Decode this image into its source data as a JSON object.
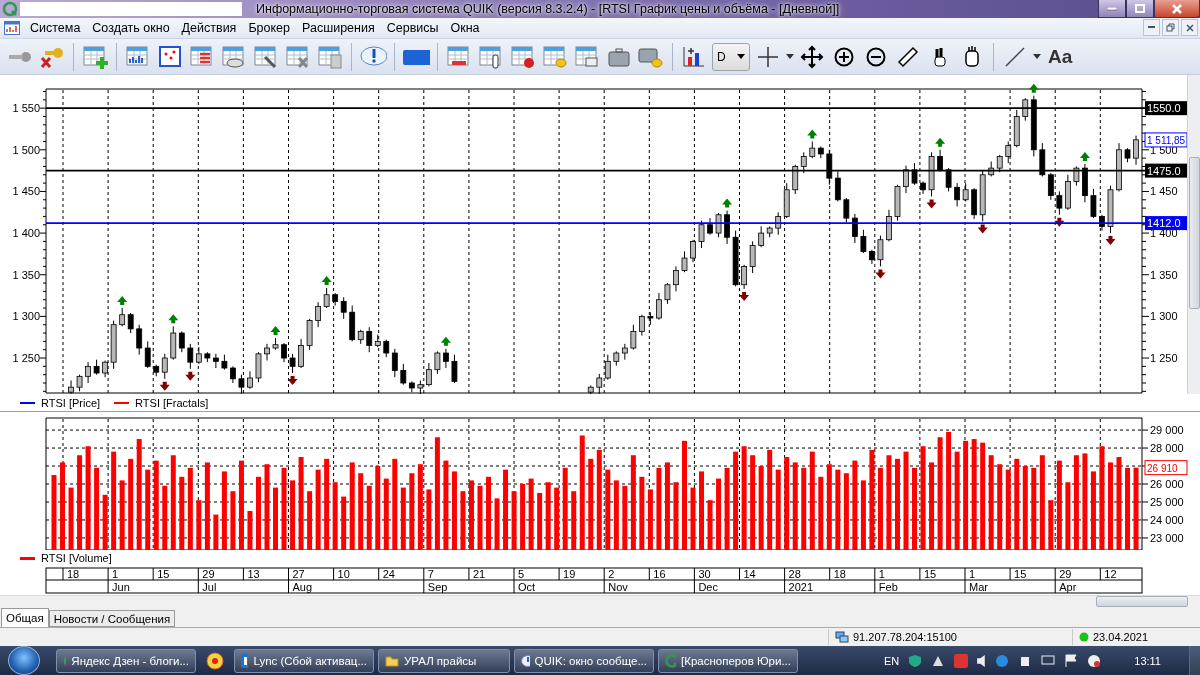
{
  "window": {
    "title": "Информационно-торговая система QUIK (версия 8.3.2.4) - [RTSI График цены и объёма - [Дневной]]"
  },
  "menu": [
    "Система",
    "Создать окно",
    "Действия",
    "Брокер",
    "Расширения",
    "Сервисы",
    "Окна"
  ],
  "toolbar": {
    "interval": "D",
    "font_button": "Aa"
  },
  "price_chart": {
    "legend": [
      {
        "label": "RTSI [Price]",
        "color": "#0000ff"
      },
      {
        "label": "RTSI [Fractals]",
        "color": "#ff0000"
      }
    ],
    "right_axis": {
      "labels": [
        "1 500",
        "1 450",
        "1 400",
        "1 350",
        "1 300",
        "1 250"
      ]
    },
    "chart_data": {
      "type": "candlestick",
      "ylim": [
        1208,
        1573
      ],
      "grid": true,
      "yticks": [
        {
          "value": 1250,
          "label": "1 250"
        },
        {
          "value": 1300,
          "label": "1 300"
        },
        {
          "value": 1350,
          "label": "1 350"
        },
        {
          "value": 1400,
          "label": "1 400"
        },
        {
          "value": 1450,
          "label": "1 450"
        },
        {
          "value": 1500,
          "label": "1 500"
        },
        {
          "value": 1550,
          "label": "1 550"
        }
      ],
      "ohlc": [
        null,
        null,
        [
          1209,
          1223,
          1207,
          1215
        ],
        [
          1215,
          1230,
          1210,
          1228
        ],
        [
          1228,
          1245,
          1220,
          1240
        ],
        [
          1240,
          1248,
          1230,
          1232
        ],
        [
          1232,
          1247,
          1227,
          1245
        ],
        [
          1245,
          1295,
          1237,
          1290
        ],
        [
          1290,
          1310,
          1288,
          1302
        ],
        [
          1302,
          1304,
          1280,
          1285
        ],
        [
          1285,
          1290,
          1254,
          1262
        ],
        [
          1262,
          1270,
          1238,
          1240
        ],
        [
          1240,
          1242,
          1228,
          1233
        ],
        [
          1233,
          1255,
          1225,
          1250
        ],
        [
          1250,
          1288,
          1248,
          1280
        ],
        [
          1280,
          1282,
          1257,
          1262
        ],
        [
          1262,
          1267,
          1237,
          1245
        ],
        [
          1245,
          1263,
          1243,
          1255
        ],
        [
          1255,
          1257,
          1245,
          1250
        ],
        [
          1250,
          1255,
          1238,
          1246
        ],
        [
          1246,
          1254,
          1236,
          1238
        ],
        [
          1238,
          1240,
          1220,
          1225
        ],
        [
          1225,
          1230,
          1207,
          1215
        ],
        [
          1215,
          1234,
          1213,
          1226
        ],
        [
          1226,
          1257,
          1221,
          1255
        ],
        [
          1255,
          1267,
          1247,
          1262
        ],
        [
          1262,
          1274,
          1260,
          1266
        ],
        [
          1266,
          1268,
          1245,
          1250
        ],
        [
          1250,
          1255,
          1232,
          1240
        ],
        [
          1240,
          1273,
          1238,
          1265
        ],
        [
          1265,
          1297,
          1260,
          1295
        ],
        [
          1295,
          1317,
          1287,
          1312
        ],
        [
          1312,
          1334,
          1310,
          1326
        ],
        [
          1326,
          1328,
          1313,
          1318
        ],
        [
          1318,
          1323,
          1297,
          1305
        ],
        [
          1305,
          1313,
          1270,
          1272
        ],
        [
          1272,
          1284,
          1267,
          1282
        ],
        [
          1282,
          1287,
          1257,
          1265
        ],
        [
          1265,
          1278,
          1263,
          1270
        ],
        [
          1270,
          1272,
          1251,
          1256
        ],
        [
          1256,
          1261,
          1227,
          1235
        ],
        [
          1235,
          1243,
          1218,
          1220
        ],
        [
          1220,
          1222,
          1209,
          1214
        ],
        [
          1214,
          1223,
          1206,
          1218
        ],
        [
          1218,
          1244,
          1216,
          1236
        ],
        [
          1236,
          1258,
          1231,
          1256
        ],
        [
          1256,
          1261,
          1238,
          1246
        ],
        [
          1246,
          1254,
          1220,
          1222
        ],
        null,
        null,
        null,
        null,
        null,
        null,
        null,
        null,
        null,
        null,
        null,
        null,
        null,
        null,
        null,
        [
          1209,
          1217,
          1204,
          1215
        ],
        [
          1215,
          1231,
          1207,
          1226
        ],
        [
          1226,
          1254,
          1224,
          1246
        ],
        [
          1246,
          1258,
          1241,
          1256
        ],
        [
          1256,
          1267,
          1248,
          1262
        ],
        [
          1262,
          1290,
          1260,
          1282
        ],
        [
          1282,
          1302,
          1277,
          1300
        ],
        [
          1300,
          1305,
          1290,
          1298
        ],
        [
          1298,
          1328,
          1296,
          1320
        ],
        [
          1320,
          1340,
          1315,
          1338
        ],
        [
          1338,
          1360,
          1330,
          1355
        ],
        [
          1355,
          1378,
          1353,
          1370
        ],
        [
          1370,
          1392,
          1365,
          1390
        ],
        [
          1390,
          1415,
          1382,
          1410
        ],
        [
          1410,
          1418,
          1398,
          1400
        ],
        [
          1400,
          1424,
          1395,
          1422
        ],
        [
          1422,
          1427,
          1387,
          1395
        ],
        [
          1395,
          1403,
          1336,
          1338
        ],
        [
          1338,
          1362,
          1333,
          1360
        ],
        [
          1360,
          1390,
          1352,
          1385
        ],
        [
          1385,
          1408,
          1383,
          1400
        ],
        [
          1400,
          1408,
          1395,
          1406
        ],
        [
          1406,
          1425,
          1398,
          1420
        ],
        [
          1420,
          1460,
          1418,
          1452
        ],
        [
          1452,
          1482,
          1447,
          1480
        ],
        [
          1480,
          1497,
          1472,
          1492
        ],
        [
          1492,
          1510,
          1490,
          1502
        ],
        [
          1502,
          1504,
          1490,
          1495
        ],
        [
          1495,
          1500,
          1458,
          1466
        ],
        [
          1466,
          1474,
          1438,
          1440
        ],
        [
          1440,
          1442,
          1413,
          1418
        ],
        [
          1418,
          1423,
          1388,
          1396
        ],
        [
          1396,
          1404,
          1376,
          1378
        ],
        [
          1378,
          1380,
          1363,
          1368
        ],
        [
          1368,
          1397,
          1360,
          1392
        ],
        [
          1392,
          1428,
          1390,
          1420
        ],
        [
          1420,
          1458,
          1415,
          1456
        ],
        [
          1456,
          1481,
          1448,
          1476
        ],
        [
          1476,
          1484,
          1458,
          1460
        ],
        [
          1460,
          1462,
          1447,
          1452
        ],
        [
          1452,
          1497,
          1444,
          1492
        ],
        [
          1492,
          1500,
          1474,
          1476
        ],
        [
          1476,
          1478,
          1450,
          1455
        ],
        [
          1455,
          1460,
          1432,
          1440
        ],
        [
          1440,
          1460,
          1438,
          1452
        ],
        [
          1452,
          1454,
          1417,
          1422
        ],
        [
          1422,
          1475,
          1414,
          1470
        ],
        [
          1470,
          1486,
          1468,
          1478
        ],
        [
          1478,
          1494,
          1473,
          1492
        ],
        [
          1492,
          1510,
          1484,
          1505
        ],
        [
          1505,
          1548,
          1503,
          1540
        ],
        [
          1540,
          1562,
          1535,
          1560
        ],
        [
          1560,
          1565,
          1492,
          1500
        ],
        [
          1500,
          1508,
          1468,
          1470
        ],
        [
          1470,
          1472,
          1440,
          1445
        ],
        [
          1445,
          1450,
          1422,
          1430
        ],
        [
          1430,
          1470,
          1428,
          1462
        ],
        [
          1462,
          1480,
          1457,
          1478
        ],
        [
          1478,
          1483,
          1437,
          1445
        ],
        [
          1445,
          1453,
          1418,
          1420
        ],
        [
          1420,
          1422,
          1403,
          1408
        ],
        [
          1408,
          1457,
          1400,
          1452
        ],
        [
          1452,
          1508,
          1450,
          1500
        ],
        [
          1500,
          1502,
          1485,
          1490
        ],
        [
          1490,
          1517,
          1482,
          1512
        ]
      ],
      "ref_lines": [
        {
          "axis": "y",
          "value": 1550,
          "label": "1550.0",
          "color": "#000000"
        },
        {
          "axis": "y",
          "value": 1475,
          "label": "1475.0",
          "color": "#000000"
        },
        {
          "axis": "y",
          "value": 1412,
          "label": "1412.0",
          "color": "#0000ff"
        }
      ],
      "annotations": [
        {
          "y": 1511.85,
          "text": "1 511,85"
        }
      ]
    }
  },
  "volume_chart": {
    "legend": [
      {
        "label": "RTSI [Volume]",
        "color": "#ff0000"
      }
    ],
    "chart_data": {
      "type": "bar",
      "ylim": [
        22330,
        29670
      ],
      "grid": true,
      "yticks": [
        {
          "value": 23000,
          "label": "23 000"
        },
        {
          "value": 24000,
          "label": "24 000"
        },
        {
          "value": 25000,
          "label": "25 000"
        },
        {
          "value": 26000,
          "label": "26 000"
        },
        {
          "value": 28000,
          "label": "28 000"
        },
        {
          "value": 29000,
          "label": "29 000"
        }
      ],
      "values": [
        26500,
        27200,
        25800,
        27600,
        28100,
        26900,
        25400,
        27800,
        26200,
        27400,
        28500,
        26800,
        27300,
        25900,
        27600,
        26400,
        26900,
        25100,
        27200,
        24300,
        26700,
        25600,
        27300,
        24500,
        26400,
        27100,
        25800,
        26900,
        26200,
        27500,
        25600,
        26800,
        27400,
        26100,
        25300,
        27200,
        26600,
        25900,
        27000,
        26300,
        27400,
        25800,
        26600,
        27100,
        25700,
        28600,
        27300,
        26700,
        25600,
        26200,
        25900,
        26400,
        25200,
        26800,
        25600,
        26000,
        26300,
        25500,
        26100,
        25800,
        26900,
        25600,
        28700,
        27400,
        27900,
        26800,
        26200,
        25900,
        27600,
        26400,
        25700,
        26900,
        27200,
        26100,
        28400,
        25800,
        26700,
        25100,
        26300,
        26900,
        27800,
        28100,
        27600,
        27000,
        27900,
        26800,
        27500,
        27200,
        26900,
        27800,
        26400,
        27100,
        26800,
        26600,
        27300,
        26200,
        27900,
        26900,
        27600,
        27400,
        27800,
        26900,
        28100,
        27200,
        28600,
        28900,
        27800,
        28400,
        28500,
        28300,
        27600,
        27100,
        26800,
        27400,
        27000,
        26900,
        27600,
        25100,
        27300,
        26100,
        27600,
        27700,
        26700,
        28100,
        27200,
        27500,
        26900,
        26910
      ],
      "annotations": [
        "26 910"
      ]
    }
  },
  "date_axis": {
    "ticks": [
      {
        "label": "18"
      },
      {
        "label": "1",
        "month": "Jun"
      },
      {
        "label": "15"
      },
      {
        "label": "29",
        "month": "Jul"
      },
      {
        "label": "13"
      },
      {
        "label": "27",
        "month": "Aug"
      },
      {
        "label": "10"
      },
      {
        "label": "24"
      },
      {
        "label": "7",
        "month": "Sep"
      },
      {
        "label": "21"
      },
      {
        "label": "5",
        "month": "Oct"
      },
      {
        "label": "19"
      },
      {
        "label": "2",
        "month": "Nov"
      },
      {
        "label": "16"
      },
      {
        "label": "30",
        "month": "Dec"
      },
      {
        "label": "14"
      },
      {
        "label": "28",
        "month": "2021"
      },
      {
        "label": "18"
      },
      {
        "label": "1",
        "month": "Feb"
      },
      {
        "label": "15"
      },
      {
        "label": "1",
        "month": "Mar"
      },
      {
        "label": "15"
      },
      {
        "label": "29",
        "month": "Apr"
      },
      {
        "label": "12"
      }
    ]
  },
  "tabs": [
    {
      "label": "Общая",
      "selected": true
    },
    {
      "label": "Новости / Сообщения",
      "selected": false
    }
  ],
  "status_bar": {
    "connection": "91.207.78.204:15100",
    "date": "23.04.2021"
  },
  "taskbar": {
    "items": [
      {
        "label": "Яндекс Дзен - блоги...",
        "kind": "browser"
      },
      {
        "label": "Lync (Сбой активац...",
        "kind": "lync"
      },
      {
        "label": "УРАЛ прайсы",
        "kind": "folder"
      },
      {
        "label": "QUIK: окно сообще...",
        "kind": "alert"
      },
      {
        "label": "[Красноперов Юри...",
        "kind": "quik"
      }
    ],
    "language": "EN",
    "clock": "13:11"
  }
}
